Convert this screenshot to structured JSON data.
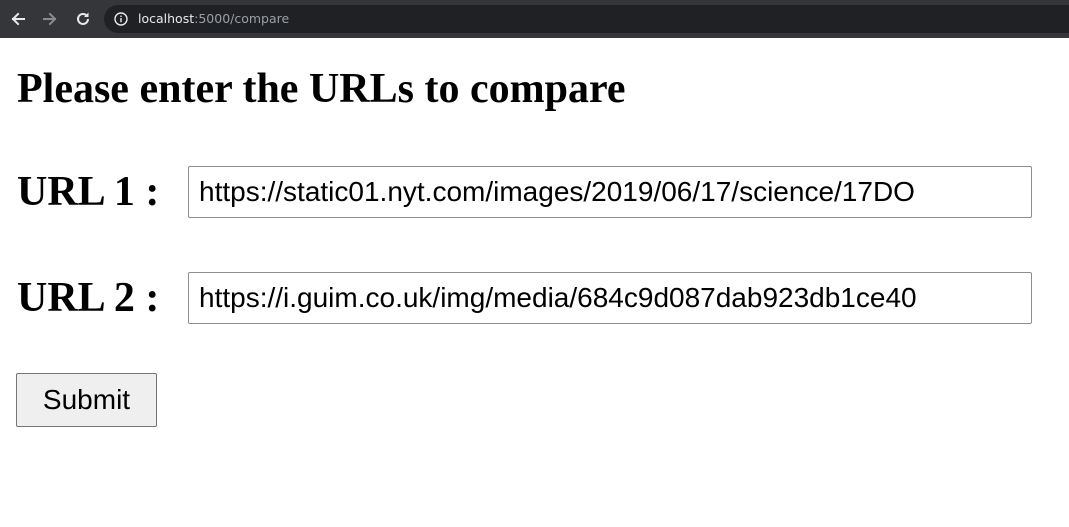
{
  "browser": {
    "url_host": "localhost",
    "url_path": ":5000/compare",
    "icons": {
      "back": "back-arrow-icon",
      "forward": "forward-arrow-icon",
      "reload": "reload-icon",
      "info": "info-icon"
    }
  },
  "page": {
    "title": "Please enter the URLs to compare",
    "url1": {
      "label": "URL 1 :",
      "value": "https://static01.nyt.com/images/2019/06/17/science/17DO"
    },
    "url2": {
      "label": "URL 2 :",
      "value": "https://i.guim.co.uk/img/media/684c9d087dab923db1ce40"
    },
    "submit_label": "Submit"
  },
  "colors": {
    "browser_bar": "#35363a",
    "address_bar": "#202124",
    "button_bg": "#efefef"
  }
}
